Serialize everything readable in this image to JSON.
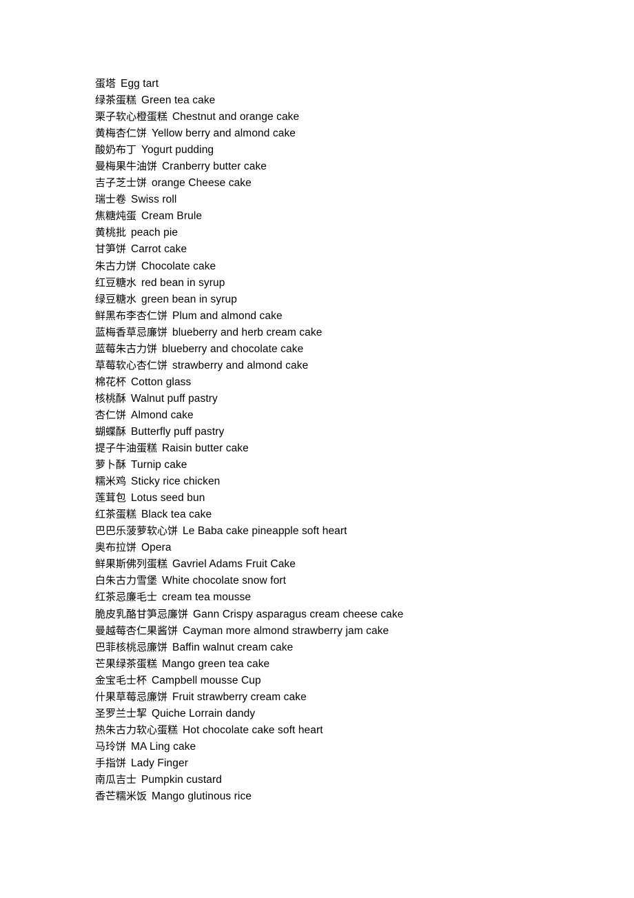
{
  "document": {
    "background_color": "#ffffff",
    "text_color": "#000000",
    "entries": [
      {
        "zh": "蛋塔",
        "en": "Egg tart"
      },
      {
        "zh": "绿茶蛋糕",
        "en": "Green tea cake"
      },
      {
        "zh": "栗子软心橙蛋糕",
        "en": "Chestnut and orange cake"
      },
      {
        "zh": "黄梅杏仁饼",
        "en": "Yellow berry and almond cake"
      },
      {
        "zh": "酸奶布丁",
        "en": "Yogurt pudding"
      },
      {
        "zh": "曼梅果牛油饼",
        "en": "Cranberry butter cake"
      },
      {
        "zh": "吉子芝士饼",
        "en": "orange Cheese cake"
      },
      {
        "zh": "瑞士卷",
        "en": "Swiss roll"
      },
      {
        "zh": "焦糖炖蛋",
        "en": "Cream Brule"
      },
      {
        "zh": "黄桃批",
        "en": "peach pie"
      },
      {
        "zh": "甘笋饼",
        "en": "Carrot cake"
      },
      {
        "zh": "朱古力饼",
        "en": "Chocolate cake"
      },
      {
        "zh": "红豆糖水",
        "en": "red bean in syrup"
      },
      {
        "zh": "绿豆糖水",
        "en": "green bean in syrup"
      },
      {
        "zh": "鲜黑布李杏仁饼",
        "en": "Plum and almond cake"
      },
      {
        "zh": "蓝梅香草忌廉饼",
        "en": "blueberry and herb cream cake"
      },
      {
        "zh": "蓝莓朱古力饼",
        "en": "blueberry and chocolate cake"
      },
      {
        "zh": "草莓软心杏仁饼",
        "en": "strawberry and almond cake"
      },
      {
        "zh": "棉花杯",
        "en": "Cotton glass"
      },
      {
        "zh": "核桃酥",
        "en": "Walnut puff pastry"
      },
      {
        "zh": "杏仁饼",
        "en": "Almond cake"
      },
      {
        "zh": "蝴蝶酥",
        "en": "Butterfly puff pastry"
      },
      {
        "zh": "提子牛油蛋糕",
        "en": "Raisin butter cake"
      },
      {
        "zh": "萝卜酥",
        "en": "Turnip cake"
      },
      {
        "zh": "糯米鸡",
        "en": "Sticky rice chicken"
      },
      {
        "zh": "莲茸包",
        "en": "Lotus seed bun"
      },
      {
        "zh": "红茶蛋糕",
        "en": "Black tea cake"
      },
      {
        "zh": "巴巴乐菠萝软心饼",
        "en": "Le Baba cake pineapple soft heart"
      },
      {
        "zh": "奥布拉饼",
        "en": "Opera"
      },
      {
        "zh": "鲜果斯佛列蛋糕",
        "en": "Gavriel Adams Fruit Cake"
      },
      {
        "zh": "白朱古力雪堡",
        "en": "White chocolate snow fort"
      },
      {
        "zh": "红茶忌廉毛士",
        "en": "cream tea mousse"
      },
      {
        "zh": "脆皮乳酪甘笋忌廉饼",
        "en": "Gann Crispy asparagus cream cheese cake"
      },
      {
        "zh": "曼越莓杏仁果酱饼",
        "en": "Cayman more almond strawberry jam cake"
      },
      {
        "zh": "巴菲核桃忌廉饼",
        "en": "Baffin walnut cream cake"
      },
      {
        "zh": "芒果绿茶蛋糕",
        "en": "Mango green tea cake"
      },
      {
        "zh": "金宝毛士杯",
        "en": "Campbell mousse Cup"
      },
      {
        "zh": "什果草莓忌廉饼",
        "en": "Fruit strawberry cream cake"
      },
      {
        "zh": "圣罗兰士挈",
        "en": "Quiche Lorrain dandy"
      },
      {
        "zh": "热朱古力软心蛋糕",
        "en": "Hot chocolate cake soft heart"
      },
      {
        "zh": "马玲饼",
        "en": "MA Ling cake"
      },
      {
        "zh": "手指饼",
        "en": "Lady Finger"
      },
      {
        "zh": "南瓜吉士",
        "en": "Pumpkin custard"
      },
      {
        "zh": "香芒糯米饭",
        "en": "Mango glutinous rice"
      }
    ]
  }
}
